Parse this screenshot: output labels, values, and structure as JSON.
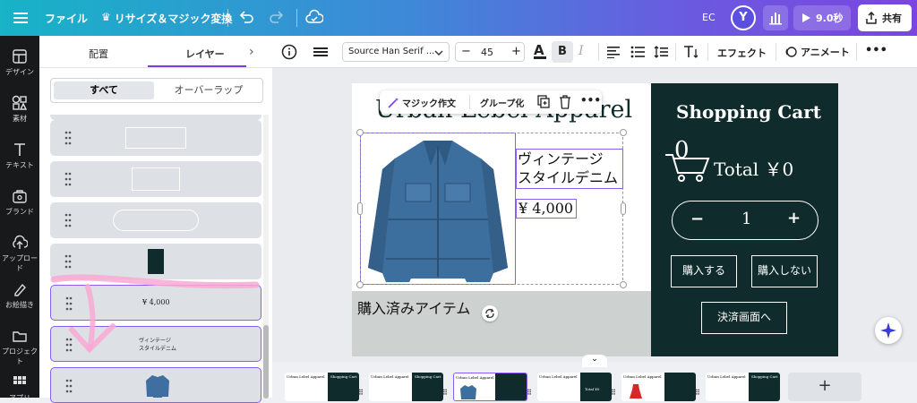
{
  "header": {
    "file": "ファイル",
    "resize": "リサイズ＆マジック変換",
    "ec": "EC",
    "avatar": "Y",
    "play": "9.0秒",
    "share": "共有"
  },
  "rail": {
    "items": [
      {
        "label": "デザイン",
        "icon": "layout-icon"
      },
      {
        "label": "素材",
        "icon": "shapes-icon"
      },
      {
        "label": "テキスト",
        "icon": "text-icon"
      },
      {
        "label": "ブランド",
        "icon": "brand-icon"
      },
      {
        "label": "アップロード",
        "icon": "upload-icon"
      },
      {
        "label": "お絵描き",
        "icon": "draw-icon"
      },
      {
        "label": "プロジェクト",
        "icon": "folder-icon"
      },
      {
        "label": "アプリ",
        "icon": "apps-icon"
      }
    ]
  },
  "panel": {
    "tab_arrange": "配置",
    "tab_layers": "レイヤー",
    "seg_all": "すべて",
    "seg_overlap": "オーバーラップ",
    "layer_price": "¥ 4,000",
    "layer_name_1": "ヴィンテージ",
    "layer_name_2": "スタイルデニム"
  },
  "toolbar": {
    "font": "Source Han Serif ...",
    "size": "45",
    "effect": "エフェクト",
    "animate": "アニメート"
  },
  "floating": {
    "magic": "マジック作文",
    "group": "グループ化"
  },
  "design": {
    "title": "Urban Lebel Apparel",
    "product_name_1": "ヴィンテージ",
    "product_name_2": "スタイルデニム",
    "price": "¥ 4,000",
    "purchased": "購入済みアイテム",
    "cart_title": "Shopping Cart",
    "cart_count": "0",
    "total": "Total ￥0",
    "qty": "1",
    "minus": "−",
    "plus": "+",
    "buy": "購入する",
    "no_buy": "購入しない",
    "checkout": "決済画面へ"
  },
  "thumbs": {
    "title": "Urban Lebel Apparel",
    "cart": "Shopping Cart",
    "total": "Total ¥0"
  },
  "colors": {
    "dark_panel": "#0f2b2b",
    "accent": "#8b5cf6"
  }
}
